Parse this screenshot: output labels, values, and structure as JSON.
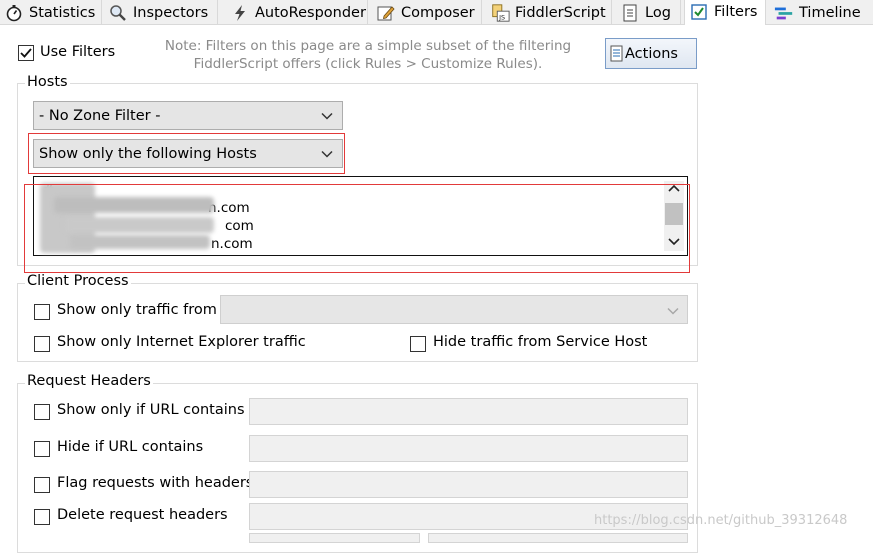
{
  "tabs": [
    {
      "label": "Statistics",
      "icon": "stopwatch-icon"
    },
    {
      "label": "Inspectors",
      "icon": "magnifier-icon"
    },
    {
      "label": "AutoResponder",
      "icon": "lightning-icon"
    },
    {
      "label": "Composer",
      "icon": "pencil-icon"
    },
    {
      "label": "FiddlerScript",
      "icon": "script-icon"
    },
    {
      "label": "Log",
      "icon": "log-icon"
    },
    {
      "label": "Filters",
      "icon": "checkbox-icon"
    },
    {
      "label": "Timeline",
      "icon": "timeline-icon"
    }
  ],
  "active_tab": "Filters",
  "use_filters_label": "Use Filters",
  "note": {
    "line1": "Note: Filters on this page are a simple subset of the filtering",
    "line2": "FiddlerScript offers (click Rules > Customize Rules)."
  },
  "actions_label": "Actions",
  "hosts": {
    "title": "Hosts",
    "zone_filter": "- No Zone Filter -",
    "host_filter": "Show only the following Hosts",
    "host_lines": [
      "#",
      "n.com",
      "com",
      "n.com"
    ]
  },
  "client_process": {
    "title": "Client Process",
    "show_only_traffic_from": "Show only traffic from",
    "show_only_ie": "Show only Internet Explorer traffic",
    "hide_service_host": "Hide traffic from Service Host"
  },
  "request_headers": {
    "title": "Request Headers",
    "show_if_url": "Show only if URL contains",
    "hide_if_url": "Hide if URL contains",
    "flag_headers": "Flag requests with headers",
    "delete_headers": "Delete request headers"
  },
  "watermark": "https://blog.csdn.net/github_39312648",
  "colors": {
    "highlight_red": "#e23a3a",
    "tab_bg": "#f0f0f0",
    "note_gray": "#8a8a8a",
    "timeline_blue": "#1e6fd9"
  }
}
